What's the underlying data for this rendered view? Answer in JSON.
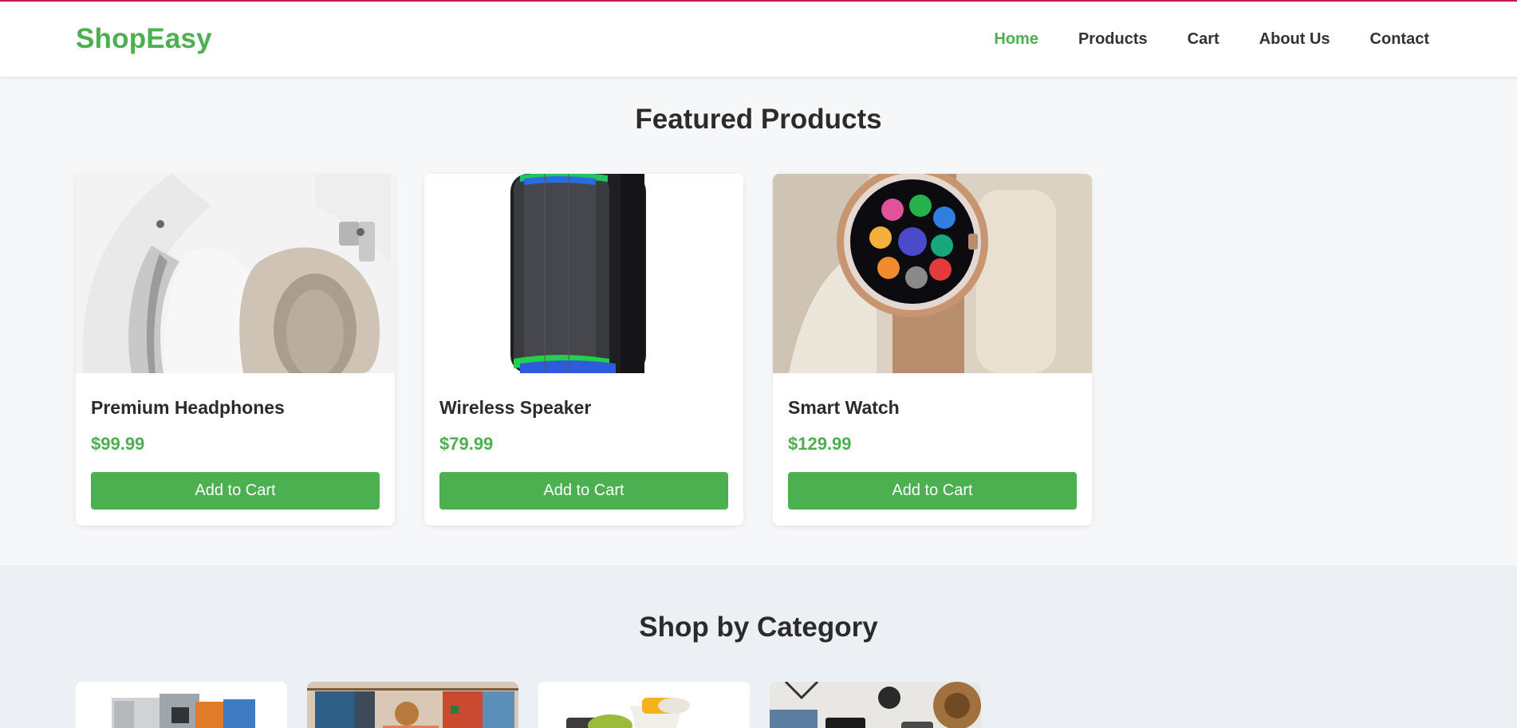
{
  "header": {
    "logo": "ShopEasy",
    "nav": [
      {
        "label": "Home",
        "active": true
      },
      {
        "label": "Products"
      },
      {
        "label": "Cart"
      },
      {
        "label": "About Us"
      },
      {
        "label": "Contact"
      }
    ]
  },
  "featured": {
    "title": "Featured Products",
    "products": [
      {
        "name": "Premium Headphones",
        "price": "$99.99",
        "button": "Add to Cart",
        "image": "headphones-image"
      },
      {
        "name": "Wireless Speaker",
        "price": "$79.99",
        "button": "Add to Cart",
        "image": "speaker-image"
      },
      {
        "name": "Smart Watch",
        "price": "$129.99",
        "button": "Add to Cart",
        "image": "smartwatch-image"
      }
    ]
  },
  "categories": {
    "title": "Shop by Category",
    "items": [
      {
        "image": "appliances-image"
      },
      {
        "image": "clothing-image"
      },
      {
        "image": "kitchenware-image"
      },
      {
        "image": "accessories-image"
      }
    ]
  },
  "colors": {
    "brand": "#4caf50",
    "top_border": "#c2185b",
    "page_bg": "#f6f7f9",
    "category_bg": "#ecf0f4"
  }
}
